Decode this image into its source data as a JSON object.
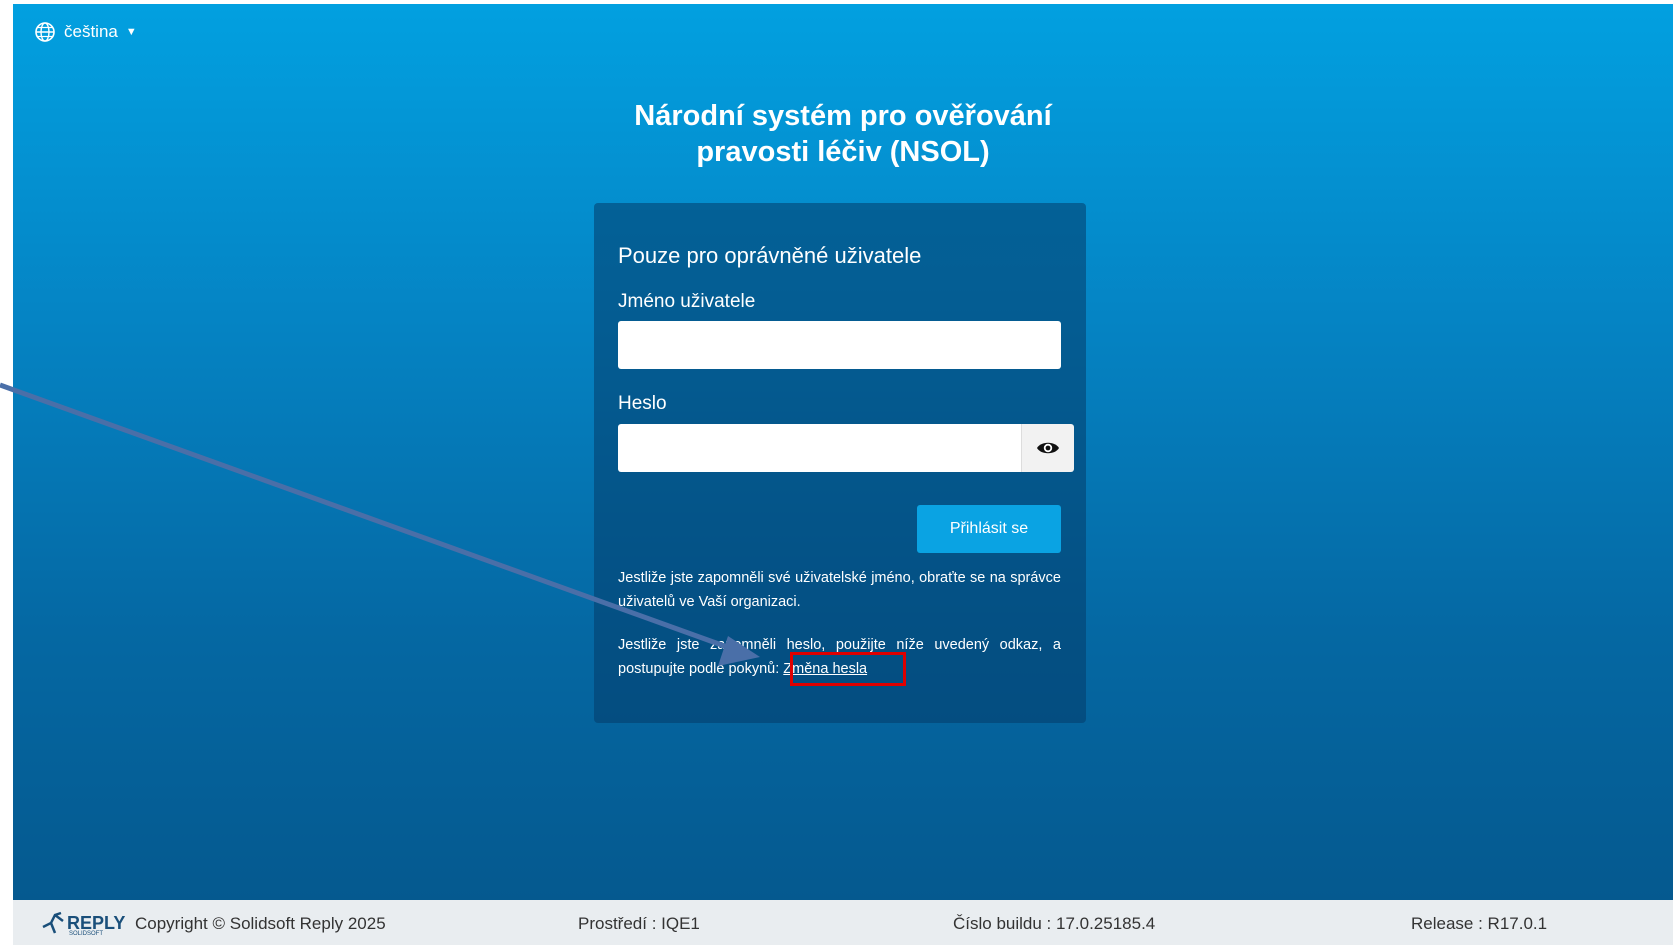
{
  "language": {
    "selected": "čeština"
  },
  "title": {
    "line1": "Národní systém pro ověřování",
    "line2": "pravosti léčiv (NSOL)"
  },
  "card": {
    "heading": "Pouze pro oprávněné uživatele",
    "username_label": "Jméno uživatele",
    "username_value": "",
    "password_label": "Heslo",
    "password_value": "",
    "login_button": "Přihlásit se",
    "forgot_username_text": "Jestliže jste zapomněli své uživatelské jméno, obraťte se na správce uživatelů ve Vaší organizaci.",
    "forgot_password_text": "Jestliže jste zapomněli heslo, použijte níže uvedený odkaz, a postupujte podle pokynů:",
    "change_password_link": "Změna hesla"
  },
  "footer": {
    "logo_text": "REPLY",
    "logo_subtext": "SOLIDSOFT",
    "copyright": "Copyright © Solidsoft Reply 2025",
    "environment": "Prostředí : IQE1",
    "build": "Číslo buildu : 17.0.25185.4",
    "release": "Release : R17.0.1"
  },
  "colors": {
    "background_top": "#02a0e0",
    "background_bottom": "#05598f",
    "button": "#0aa3e3",
    "highlight": "#e00000",
    "arrow": "#4a6fa8"
  }
}
